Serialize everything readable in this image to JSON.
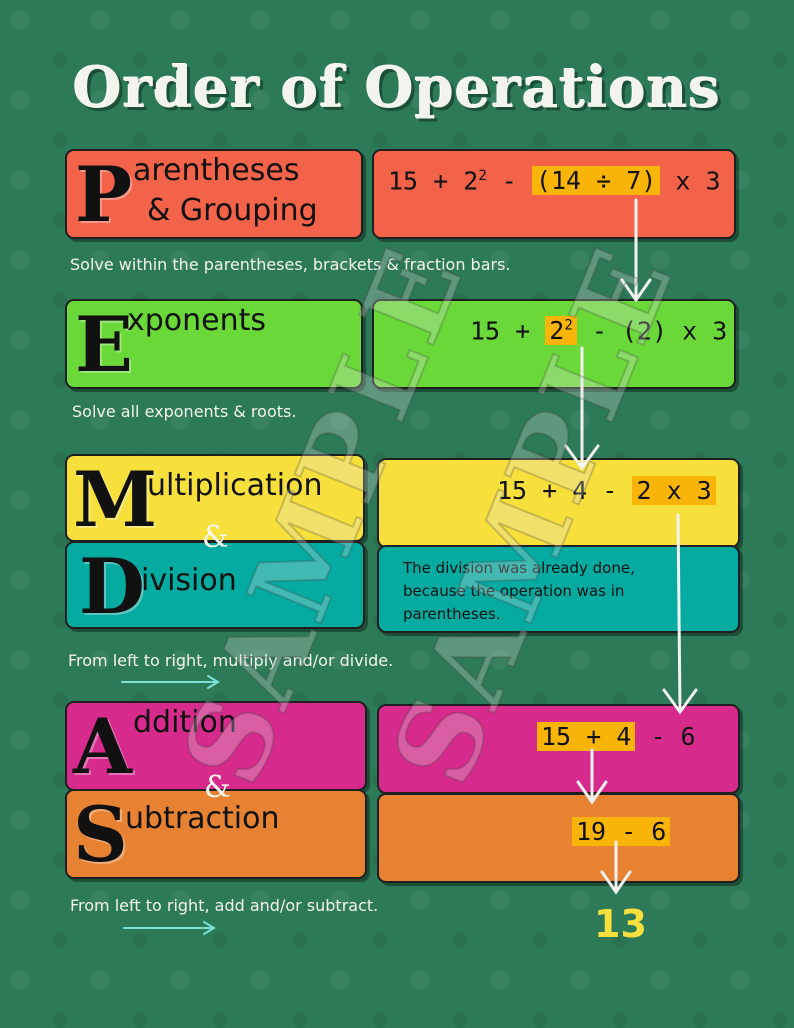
{
  "title": "Order of Operations",
  "steps": {
    "parentheses": {
      "letter": "P",
      "line1": "arentheses",
      "line2": "& Grouping",
      "equation": {
        "pre": "15 + 2",
        "exp": "2",
        "mid": " - ",
        "highlight": "(14 ÷ 7)",
        "post": " x 3"
      },
      "description": "Solve within the parentheses, brackets & fraction bars."
    },
    "exponents": {
      "letter": "E",
      "word": "xponents",
      "equation": {
        "pre": "15 + ",
        "highlight_base": "2",
        "exp": "2",
        "post": " - (2) x 3"
      },
      "description": "Solve all exponents & roots."
    },
    "multiplication": {
      "letter": "M",
      "word": "ultiplication",
      "equation": {
        "pre": "15 + 4 - ",
        "highlight": "2 x 3"
      }
    },
    "md_ampersand": "&",
    "division": {
      "letter": "D",
      "word": "ivision",
      "note": "The division was already done, because the operation was in parentheses."
    },
    "md_description": "From left to right, multiply and/or divide.",
    "addition": {
      "letter": "A",
      "word": "ddition",
      "equation": {
        "highlight": "15 + 4",
        "post": " - 6"
      }
    },
    "as_ampersand": "&",
    "subtraction": {
      "letter": "S",
      "word": "ubtraction",
      "equation": {
        "highlight": "19 - 6"
      }
    },
    "as_description": "From left to right, add and/or subtract.",
    "answer": "13"
  },
  "watermark": "SAMPLE",
  "colors": {
    "background": "#2c7a57",
    "parentheses": "#f3634a",
    "exponents": "#69d838",
    "multiplication": "#f7e03b",
    "division": "#05aaa0",
    "addition": "#d62b8d",
    "subtraction": "#e78232",
    "highlight": "#f9b408",
    "answer": "#f7e03b"
  }
}
